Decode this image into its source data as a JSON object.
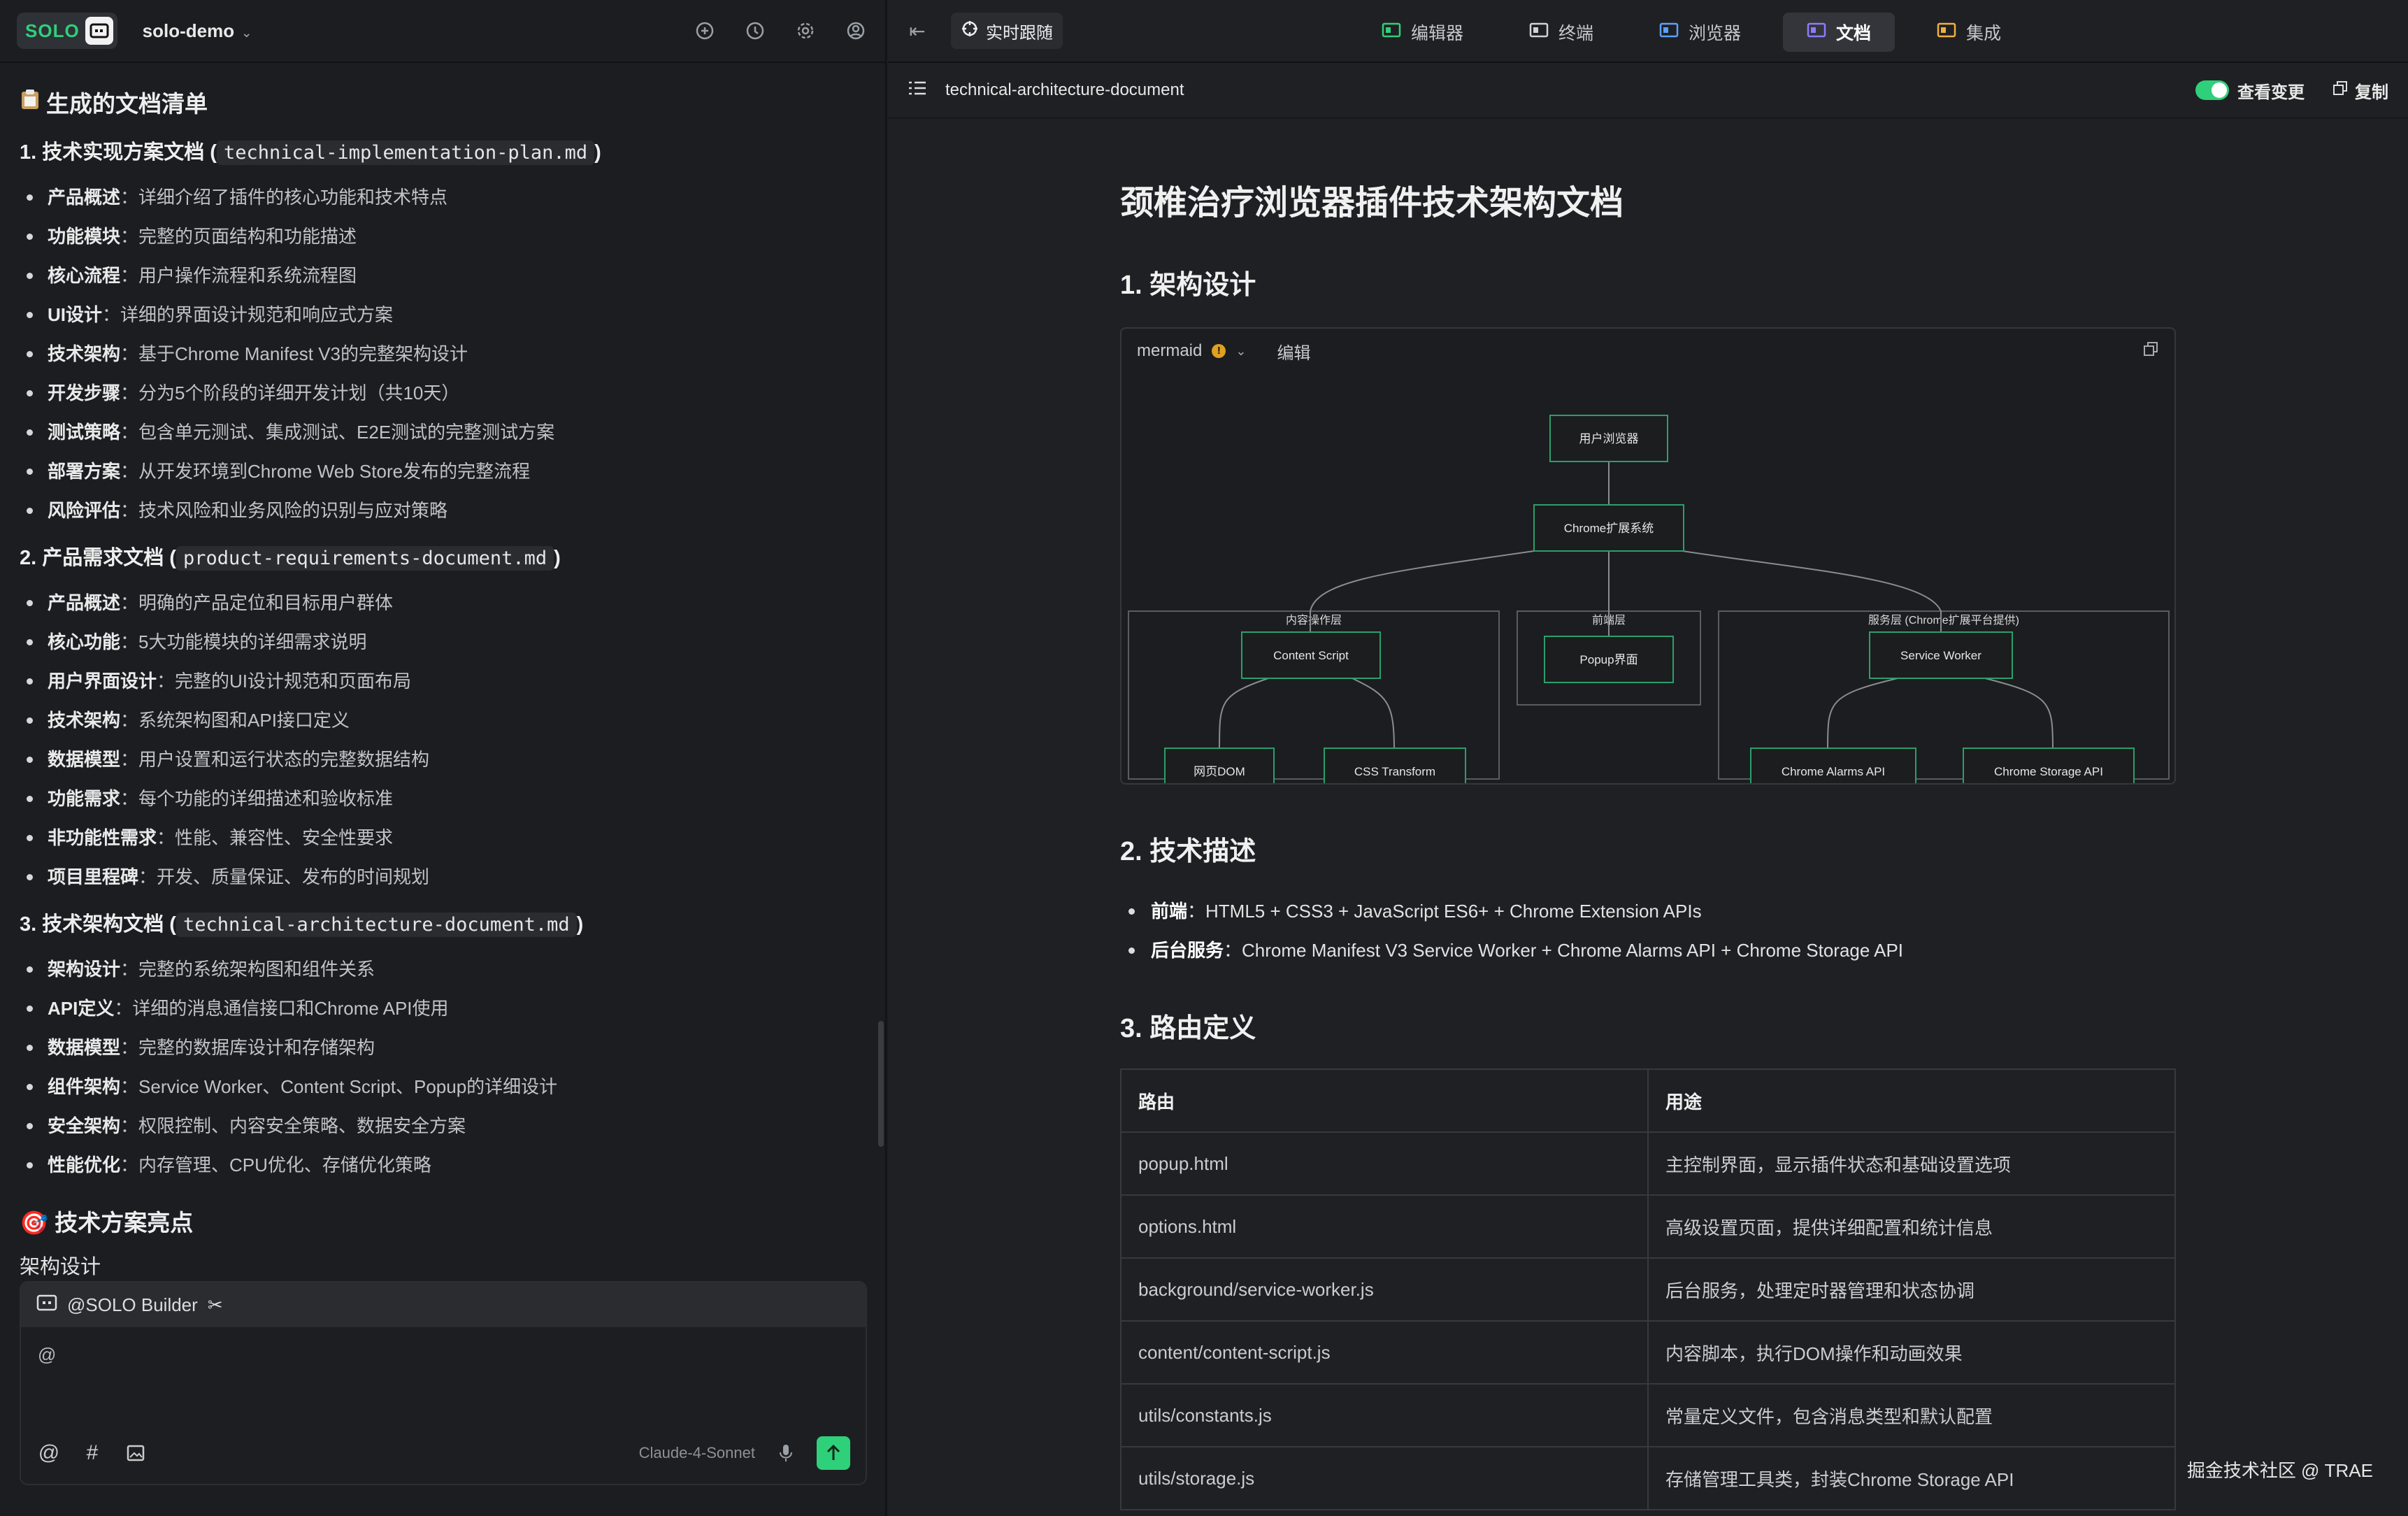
{
  "app": {
    "badge": "SOLO",
    "project": "solo-demo"
  },
  "left": {
    "heading": "生成的文档清单",
    "sections": [
      {
        "title_prefix": "1. 技术实现方案文档 (",
        "file": "technical-implementation-plan.md",
        "title_suffix": ")",
        "items": [
          {
            "k": "产品概述",
            "v": "：详细介绍了插件的核心功能和技术特点"
          },
          {
            "k": "功能模块",
            "v": "：完整的页面结构和功能描述"
          },
          {
            "k": "核心流程",
            "v": "：用户操作流程和系统流程图"
          },
          {
            "k": "UI设计",
            "v": "：详细的界面设计规范和响应式方案"
          },
          {
            "k": "技术架构",
            "v": "：基于Chrome Manifest V3的完整架构设计"
          },
          {
            "k": "开发步骤",
            "v": "：分为5个阶段的详细开发计划（共10天）"
          },
          {
            "k": "测试策略",
            "v": "：包含单元测试、集成测试、E2E测试的完整测试方案"
          },
          {
            "k": "部署方案",
            "v": "：从开发环境到Chrome Web Store发布的完整流程"
          },
          {
            "k": "风险评估",
            "v": "：技术风险和业务风险的识别与应对策略"
          }
        ]
      },
      {
        "title_prefix": "2. 产品需求文档 (",
        "file": "product-requirements-document.md",
        "title_suffix": ")",
        "items": [
          {
            "k": "产品概述",
            "v": "：明确的产品定位和目标用户群体"
          },
          {
            "k": "核心功能",
            "v": "：5大功能模块的详细需求说明"
          },
          {
            "k": "用户界面设计",
            "v": "：完整的UI设计规范和页面布局"
          },
          {
            "k": "技术架构",
            "v": "：系统架构图和API接口定义"
          },
          {
            "k": "数据模型",
            "v": "：用户设置和运行状态的完整数据结构"
          },
          {
            "k": "功能需求",
            "v": "：每个功能的详细描述和验收标准"
          },
          {
            "k": "非功能性需求",
            "v": "：性能、兼容性、安全性要求"
          },
          {
            "k": "项目里程碑",
            "v": "：开发、质量保证、发布的时间规划"
          }
        ]
      },
      {
        "title_prefix": "3. 技术架构文档 (",
        "file": "technical-architecture-document.md",
        "title_suffix": ")",
        "items": [
          {
            "k": "架构设计",
            "v": "：完整的系统架构图和组件关系"
          },
          {
            "k": "API定义",
            "v": "：详细的消息通信接口和Chrome API使用"
          },
          {
            "k": "数据模型",
            "v": "：完整的数据库设计和存储架构"
          },
          {
            "k": "组件架构",
            "v": "：Service Worker、Content Script、Popup的详细设计"
          },
          {
            "k": "安全架构",
            "v": "：权限控制、内容安全策略、数据安全方案"
          },
          {
            "k": "性能优化",
            "v": "：内存管理、CPU优化、存储优化策略"
          }
        ]
      }
    ],
    "highlights": "技术方案亮点",
    "subheading": "架构设计",
    "chat": {
      "agent": "@SOLO Builder",
      "input": "@",
      "model": "Claude-4-Sonnet"
    }
  },
  "right": {
    "live": "实时跟随",
    "tabs": [
      "编辑器",
      "终端",
      "浏览器",
      "文档",
      "集成"
    ],
    "active_tab": "文档",
    "doc_name": "technical-architecture-document",
    "view_changes": "查看变更",
    "copy": "复制",
    "title": "颈椎治疗浏览器插件技术架构文档",
    "s1": "1. 架构设计",
    "mermaid": {
      "label": "mermaid",
      "edit": "编辑",
      "nodes": {
        "browser": "用户浏览器",
        "ext": "Chrome扩展系统",
        "cs": "Content Script",
        "dom": "网页DOM",
        "css": "CSS Transform",
        "popup": "Popup界面",
        "sw": "Service Worker",
        "alarms": "Chrome Alarms API",
        "storage": "Chrome Storage API"
      },
      "groups": {
        "content": "内容操作层",
        "front": "前端层",
        "service": "服务层 (Chrome扩展平台提供)"
      }
    },
    "s2": "2. 技术描述",
    "tech": [
      {
        "k": "前端",
        "v": "：HTML5 + CSS3 + JavaScript ES6+ + Chrome Extension APIs"
      },
      {
        "k": "后台服务",
        "v": "：Chrome Manifest V3 Service Worker + Chrome Alarms API + Chrome Storage API"
      }
    ],
    "s3": "3. 路由定义",
    "table": {
      "headers": [
        "路由",
        "用途"
      ],
      "rows": [
        [
          "popup.html",
          "主控制界面，显示插件状态和基础设置选项"
        ],
        [
          "options.html",
          "高级设置页面，提供详细配置和统计信息"
        ],
        [
          "background/service-worker.js",
          "后台服务，处理定时器管理和状态协调"
        ],
        [
          "content/content-script.js",
          "内容脚本，执行DOM操作和动画效果"
        ],
        [
          "utils/constants.js",
          "常量定义文件，包含消息类型和默认配置"
        ],
        [
          "utils/storage.js",
          "存储管理工具类，封装Chrome Storage API"
        ]
      ]
    },
    "watermark": "掘金技术社区 @ TRAE"
  }
}
